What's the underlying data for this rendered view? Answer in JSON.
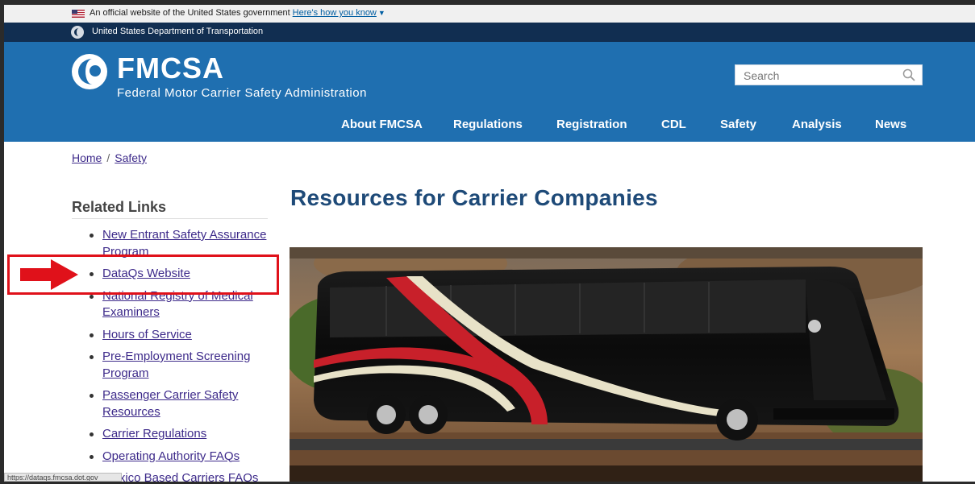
{
  "gov_banner": {
    "text": "An official website of the United States government",
    "how_link": "Here's how you know"
  },
  "agency": {
    "name": "United States Department of Transportation"
  },
  "logo": {
    "title": "FMCSA",
    "subtitle": "Federal Motor Carrier Safety Administration"
  },
  "search": {
    "placeholder": "Search"
  },
  "nav": {
    "items": [
      "About FMCSA",
      "Regulations",
      "Registration",
      "CDL",
      "Safety",
      "Analysis",
      "News"
    ]
  },
  "breadcrumb": {
    "home": "Home",
    "separator": "/",
    "current": "Safety"
  },
  "related": {
    "title": "Related Links",
    "items": [
      "New Entrant Safety Assurance Program",
      "DataQs Website",
      "National Registry of Medical Examiners",
      "Hours of Service",
      "Pre-Employment Screening Program",
      "Passenger Carrier Safety Resources",
      "Carrier Regulations",
      "Operating Authority FAQs",
      "Mexico Based Carriers FAQs"
    ]
  },
  "main": {
    "title": "Resources for Carrier Companies"
  },
  "status_bar": {
    "url": "https://dataqs.fmcsa.dot.gov"
  },
  "colors": {
    "header_blue": "#1f6fb0",
    "dot_bar": "#112e51",
    "link": "#3d2a8a",
    "title_blue": "#1e4a78",
    "annotation_red": "#e0111a"
  }
}
